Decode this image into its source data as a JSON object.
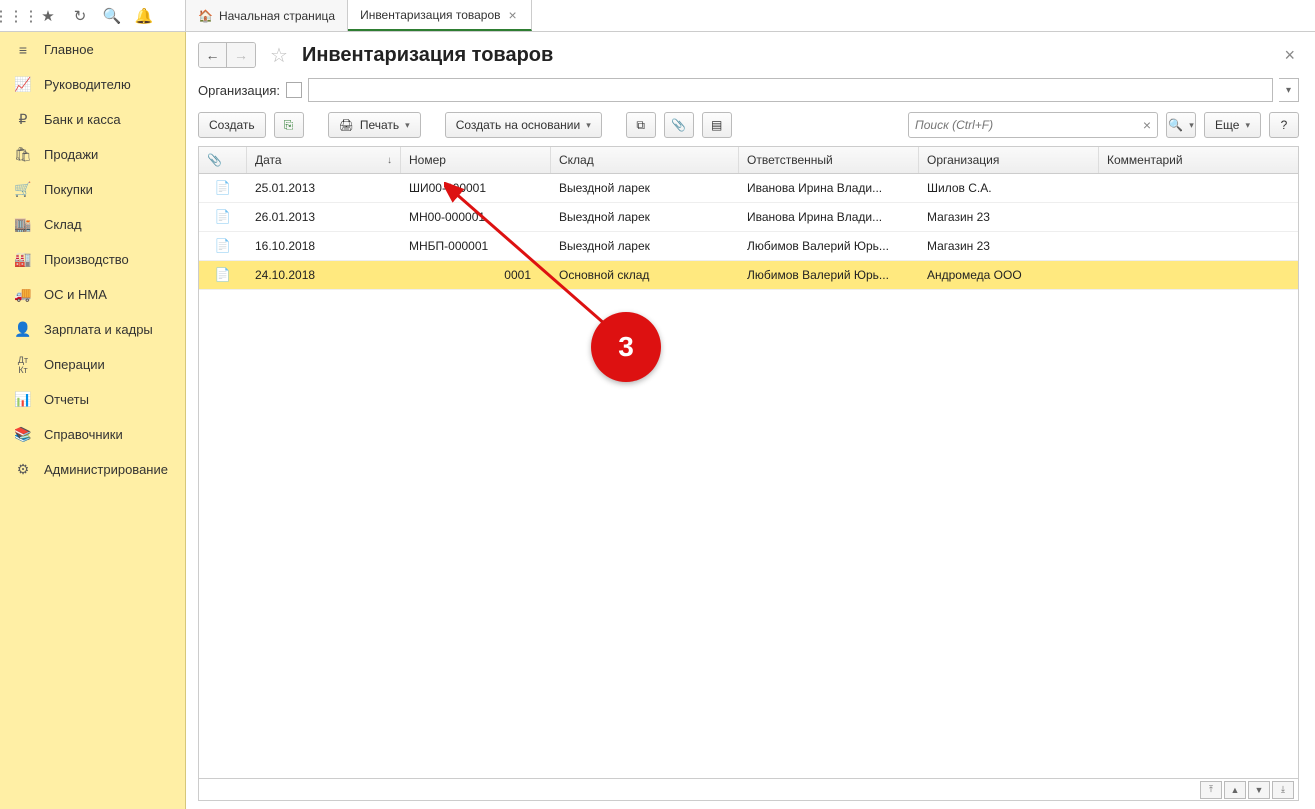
{
  "tabs": [
    {
      "label": "Начальная страница",
      "icon": "home"
    },
    {
      "label": "Инвентаризация товаров",
      "active": true,
      "closable": true
    }
  ],
  "sidebar": [
    {
      "icon": "≡",
      "label": "Главное"
    },
    {
      "icon": "📈",
      "label": "Руководителю"
    },
    {
      "icon": "₽",
      "label": "Банк и касса"
    },
    {
      "icon": "🛍",
      "label": "Продажи"
    },
    {
      "icon": "🛒",
      "label": "Покупки"
    },
    {
      "icon": "🏬",
      "label": "Склад"
    },
    {
      "icon": "🏭",
      "label": "Производство"
    },
    {
      "icon": "🚚",
      "label": "ОС и НМА"
    },
    {
      "icon": "👤",
      "label": "Зарплата и кадры"
    },
    {
      "icon": "Дт",
      "label": "Операции"
    },
    {
      "icon": "📊",
      "label": "Отчеты"
    },
    {
      "icon": "📚",
      "label": "Справочники"
    },
    {
      "icon": "⚙",
      "label": "Администрирование"
    }
  ],
  "page": {
    "title": "Инвентаризация товаров",
    "filter_label": "Организация:"
  },
  "toolbar": {
    "create": "Создать",
    "print": "Печать",
    "create_based": "Создать на основании",
    "more": "Еще",
    "search_placeholder": "Поиск (Ctrl+F)"
  },
  "columns": {
    "attach": "",
    "date": "Дата",
    "num": "Номер",
    "sklad": "Склад",
    "resp": "Ответственный",
    "org": "Организация",
    "comm": "Комментарий"
  },
  "rows": [
    {
      "date": "25.01.2013",
      "num": "ШИ00-000001",
      "sklad": "Выездной ларек",
      "resp": "Иванова Ирина Влади...",
      "org": "Шилов С.А."
    },
    {
      "date": "26.01.2013",
      "num": "МН00-000001",
      "sklad": "Выездной ларек",
      "resp": "Иванова Ирина Влади...",
      "org": "Магазин 23"
    },
    {
      "date": "16.10.2018",
      "num": "МНБП-000001",
      "sklad": "Выездной ларек",
      "resp": "Любимов Валерий Юрь...",
      "org": "Магазин 23"
    },
    {
      "date": "24.10.2018",
      "num": "0001",
      "sklad": "Основной склад",
      "resp": "Любимов Валерий Юрь...",
      "org": "Андромеда ООО",
      "selected": true
    }
  ],
  "annotation": {
    "number": "3"
  }
}
